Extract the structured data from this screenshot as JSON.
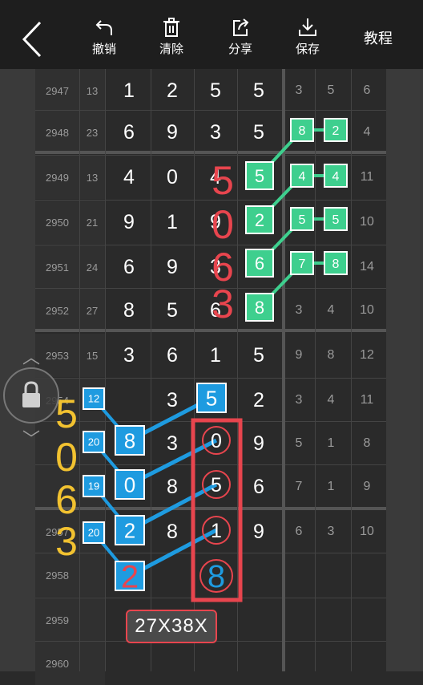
{
  "toolbar": {
    "undo_label": "撤销",
    "clear_label": "清除",
    "share_label": "分享",
    "save_label": "保存",
    "tutorial_label": "教程"
  },
  "rows": [
    {
      "id": "2947",
      "n": "13",
      "digits": [
        "1",
        "2",
        "5",
        "5"
      ],
      "stats": [
        "3",
        "5",
        "6"
      ]
    },
    {
      "id": "2948",
      "n": "23",
      "digits": [
        "6",
        "9",
        "3",
        "5"
      ],
      "stats": [
        "",
        "",
        "4"
      ]
    },
    {
      "id": "2949",
      "n": "13",
      "digits": [
        "4",
        "0",
        "4",
        ""
      ],
      "stats": [
        "",
        "",
        "11"
      ]
    },
    {
      "id": "2950",
      "n": "21",
      "digits": [
        "9",
        "1",
        "9",
        ""
      ],
      "stats": [
        "",
        "",
        "10"
      ]
    },
    {
      "id": "2951",
      "n": "24",
      "digits": [
        "6",
        "9",
        "3",
        ""
      ],
      "stats": [
        "",
        "",
        "14"
      ]
    },
    {
      "id": "2952",
      "n": "27",
      "digits": [
        "8",
        "5",
        "6",
        ""
      ],
      "stats": [
        "3",
        "4",
        "10"
      ]
    },
    {
      "id": "2953",
      "n": "15",
      "digits": [
        "3",
        "6",
        "1",
        "5"
      ],
      "stats": [
        "9",
        "8",
        "12"
      ]
    },
    {
      "id": "2954",
      "n": "",
      "digits": [
        "",
        "3",
        "",
        "2"
      ],
      "stats": [
        "3",
        "4",
        "11"
      ]
    },
    {
      "id": "",
      "n": "",
      "digits": [
        "",
        "3",
        "",
        "9"
      ],
      "stats": [
        "5",
        "1",
        "8"
      ]
    },
    {
      "id": "",
      "n": "",
      "digits": [
        "",
        "8",
        "",
        "6"
      ],
      "stats": [
        "7",
        "1",
        "9"
      ]
    },
    {
      "id": "2957",
      "n": "",
      "digits": [
        "",
        "8",
        "",
        "9"
      ],
      "stats": [
        "6",
        "3",
        "10"
      ]
    },
    {
      "id": "2958",
      "n": "",
      "digits": [
        "",
        "",
        "",
        ""
      ],
      "stats": [
        "",
        "",
        ""
      ]
    },
    {
      "id": "2959",
      "n": "",
      "digits": [
        "",
        "",
        "",
        ""
      ],
      "stats": [
        "",
        "",
        ""
      ]
    },
    {
      "id": "2960",
      "n": "",
      "digits": [
        "",
        "",
        "",
        ""
      ],
      "stats": [
        "",
        "",
        ""
      ]
    }
  ],
  "annotations": {
    "green_col": [
      "5",
      "2",
      "6",
      "8"
    ],
    "green_pairs": [
      [
        "8",
        "2"
      ],
      [
        "4",
        "4"
      ],
      [
        "5",
        "5"
      ],
      [
        "7",
        "8"
      ]
    ],
    "red_vertical": [
      "5",
      "0",
      "6",
      "3"
    ],
    "yellow_vertical": [
      "5",
      "0",
      "6",
      "3"
    ],
    "blue_small": [
      "12",
      "20",
      "19",
      "20"
    ],
    "blue_big": [
      "8",
      "0",
      "2",
      "2"
    ],
    "blue_top_box": "5",
    "circled": [
      "0",
      "5",
      "1"
    ],
    "circled_bottom": "8",
    "result_text": "27X38X"
  },
  "colors": {
    "green": "#3ecf8e",
    "blue": "#1e9be0",
    "red": "#e8454e",
    "yellow": "#f2c230"
  }
}
